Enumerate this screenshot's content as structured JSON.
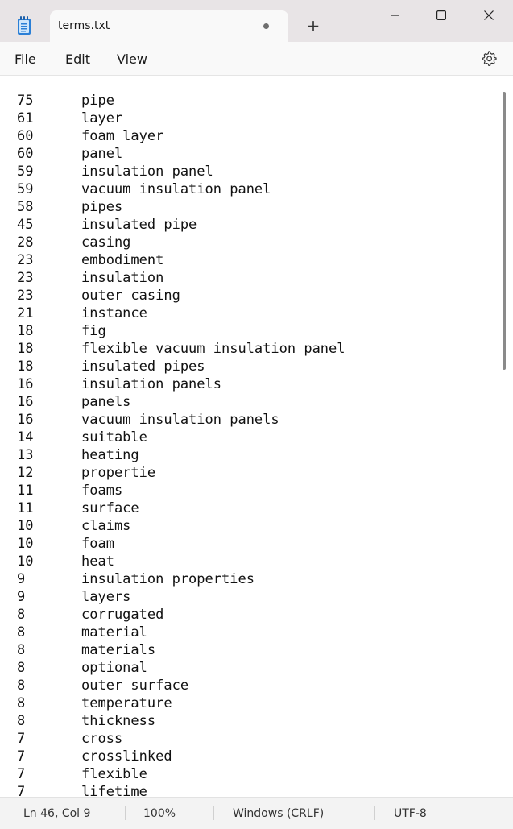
{
  "tab": {
    "title": "terms.txt",
    "new_tab": "+"
  },
  "menu": {
    "file": "File",
    "edit": "Edit",
    "view": "View"
  },
  "lines": [
    {
      "count": "75",
      "term": "pipe"
    },
    {
      "count": "61",
      "term": "layer"
    },
    {
      "count": "60",
      "term": "foam layer"
    },
    {
      "count": "60",
      "term": "panel"
    },
    {
      "count": "59",
      "term": "insulation panel"
    },
    {
      "count": "59",
      "term": "vacuum insulation panel"
    },
    {
      "count": "58",
      "term": "pipes"
    },
    {
      "count": "45",
      "term": "insulated pipe"
    },
    {
      "count": "28",
      "term": "casing"
    },
    {
      "count": "23",
      "term": "embodiment"
    },
    {
      "count": "23",
      "term": "insulation"
    },
    {
      "count": "23",
      "term": "outer casing"
    },
    {
      "count": "21",
      "term": "instance"
    },
    {
      "count": "18",
      "term": "fig"
    },
    {
      "count": "18",
      "term": "flexible vacuum insulation panel"
    },
    {
      "count": "18",
      "term": "insulated pipes"
    },
    {
      "count": "16",
      "term": "insulation panels"
    },
    {
      "count": "16",
      "term": "panels"
    },
    {
      "count": "16",
      "term": "vacuum insulation panels"
    },
    {
      "count": "14",
      "term": "suitable"
    },
    {
      "count": "13",
      "term": "heating"
    },
    {
      "count": "12",
      "term": "propertie"
    },
    {
      "count": "11",
      "term": "foams"
    },
    {
      "count": "11",
      "term": "surface"
    },
    {
      "count": "10",
      "term": "claims"
    },
    {
      "count": "10",
      "term": "foam"
    },
    {
      "count": "10",
      "term": "heat"
    },
    {
      "count": "9",
      "term": "insulation properties"
    },
    {
      "count": "9",
      "term": "layers"
    },
    {
      "count": "8",
      "term": "corrugated"
    },
    {
      "count": "8",
      "term": "material"
    },
    {
      "count": "8",
      "term": "materials"
    },
    {
      "count": "8",
      "term": "optional"
    },
    {
      "count": "8",
      "term": "outer surface"
    },
    {
      "count": "8",
      "term": "temperature"
    },
    {
      "count": "8",
      "term": "thickness"
    },
    {
      "count": "7",
      "term": "cross"
    },
    {
      "count": "7",
      "term": "crosslinked"
    },
    {
      "count": "7",
      "term": "flexible"
    },
    {
      "count": "7",
      "term": "lifetime"
    }
  ],
  "status": {
    "position": "Ln 46, Col 9",
    "zoom": "100%",
    "line_ending": "Windows (CRLF)",
    "encoding": "UTF-8"
  },
  "icons": {
    "app": "notepad-icon",
    "unsaved": "unsaved-dot-icon",
    "minimize": "minimize-icon",
    "maximize": "maximize-icon",
    "close": "close-icon",
    "settings": "gear-icon"
  }
}
